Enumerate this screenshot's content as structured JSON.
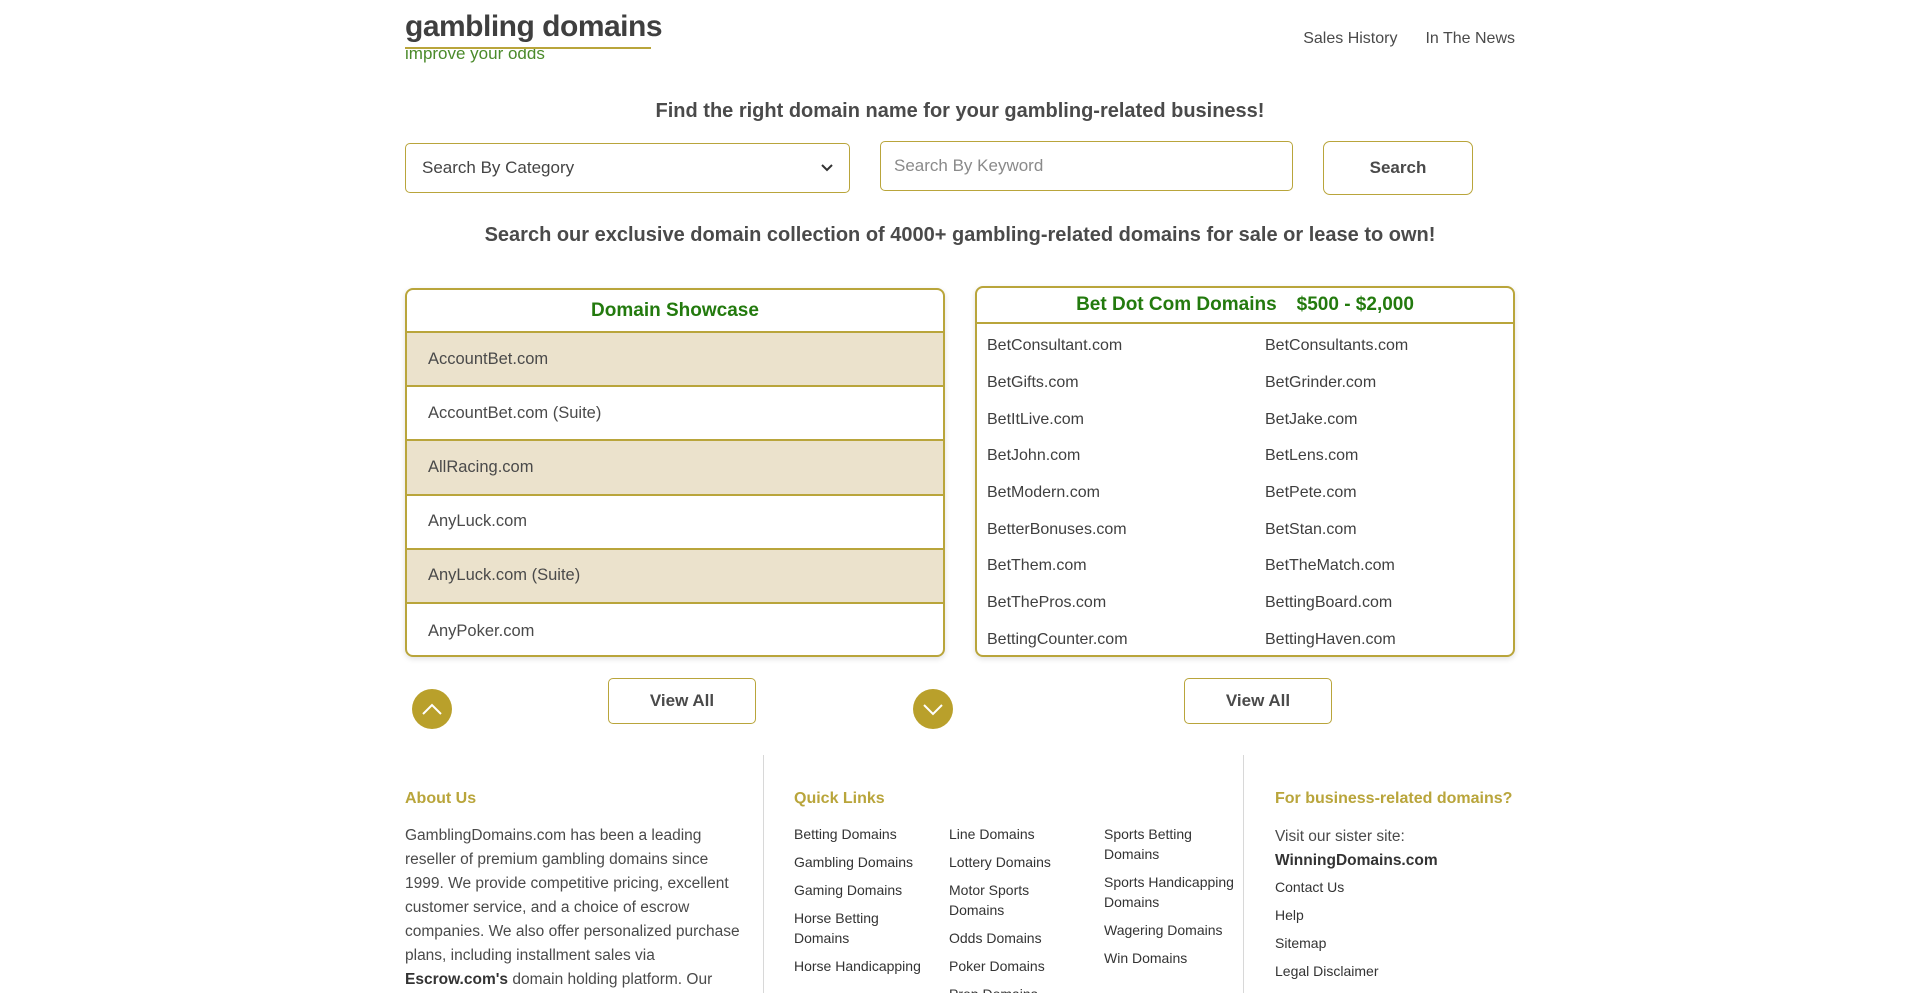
{
  "header": {
    "logo_main": "gambling domains",
    "logo_tagline": "improve your odds",
    "nav": [
      "Sales History",
      "In The News"
    ]
  },
  "search": {
    "headline": "Find the right domain name for your gambling-related business!",
    "category_select": "Search By Category",
    "keyword_placeholder": "Search By Keyword",
    "button": "Search",
    "collection_text": "Search our exclusive domain collection of 4000+ gambling-related domains for sale or lease to own!"
  },
  "showcase": {
    "title": "Domain Showcase",
    "items": [
      "AccountBet.com",
      "AccountBet.com (Suite)",
      "AllRacing.com",
      "AnyLuck.com",
      "AnyLuck.com (Suite)",
      "AnyPoker.com"
    ],
    "view_all": "View All"
  },
  "betdotcom": {
    "title": "Bet Dot Com Domains",
    "price": "$500 - $2,000",
    "items": [
      "BetConsultant.com",
      "BetConsultants.com",
      "BetGifts.com",
      "BetGrinder.com",
      "BetItLive.com",
      "BetJake.com",
      "BetJohn.com",
      "BetLens.com",
      "BetModern.com",
      "BetPete.com",
      "BetterBonuses.com",
      "BetStan.com",
      "BetThem.com",
      "BetTheMatch.com",
      "BetThePros.com",
      "BettingBoard.com",
      "BettingCounter.com",
      "BettingHaven.com"
    ],
    "view_all": "View All"
  },
  "footer": {
    "about_head": "About Us",
    "about_text_1": "GamblingDomains.com has been a leading reseller of premium gambling domains since 1999. We provide competitive pricing, excellent customer service, and a choice of escrow companies. We also offer personalized purchase plans, including installment sales via ",
    "about_bold": "Escrow.com's",
    "about_text_2": " domain holding platform. Our",
    "quick_head": "Quick Links",
    "quick_col1": [
      "Betting Domains",
      "Gambling Domains",
      "Gaming Domains",
      "Horse Betting Domains",
      "Horse Handicapping"
    ],
    "quick_col2": [
      "Line Domains",
      "Lottery Domains",
      "Motor Sports Domains",
      "Odds Domains",
      "Poker Domains",
      "Prop Domains"
    ],
    "quick_col3": [
      "Sports Betting Domains",
      "Sports Handicapping Domains",
      "Wagering Domains",
      "Win Domains"
    ],
    "biz_head": "For business-related domains?",
    "biz_visit": "Visit our sister site:",
    "biz_site": "WinningDomains.com",
    "biz_links": [
      "Contact Us",
      "Help",
      "Sitemap",
      "Legal Disclaimer"
    ]
  },
  "colors": {
    "accent_gold": "#b9a53b",
    "title_green": "#237a0e",
    "row_shade": "#ebe2cc"
  }
}
